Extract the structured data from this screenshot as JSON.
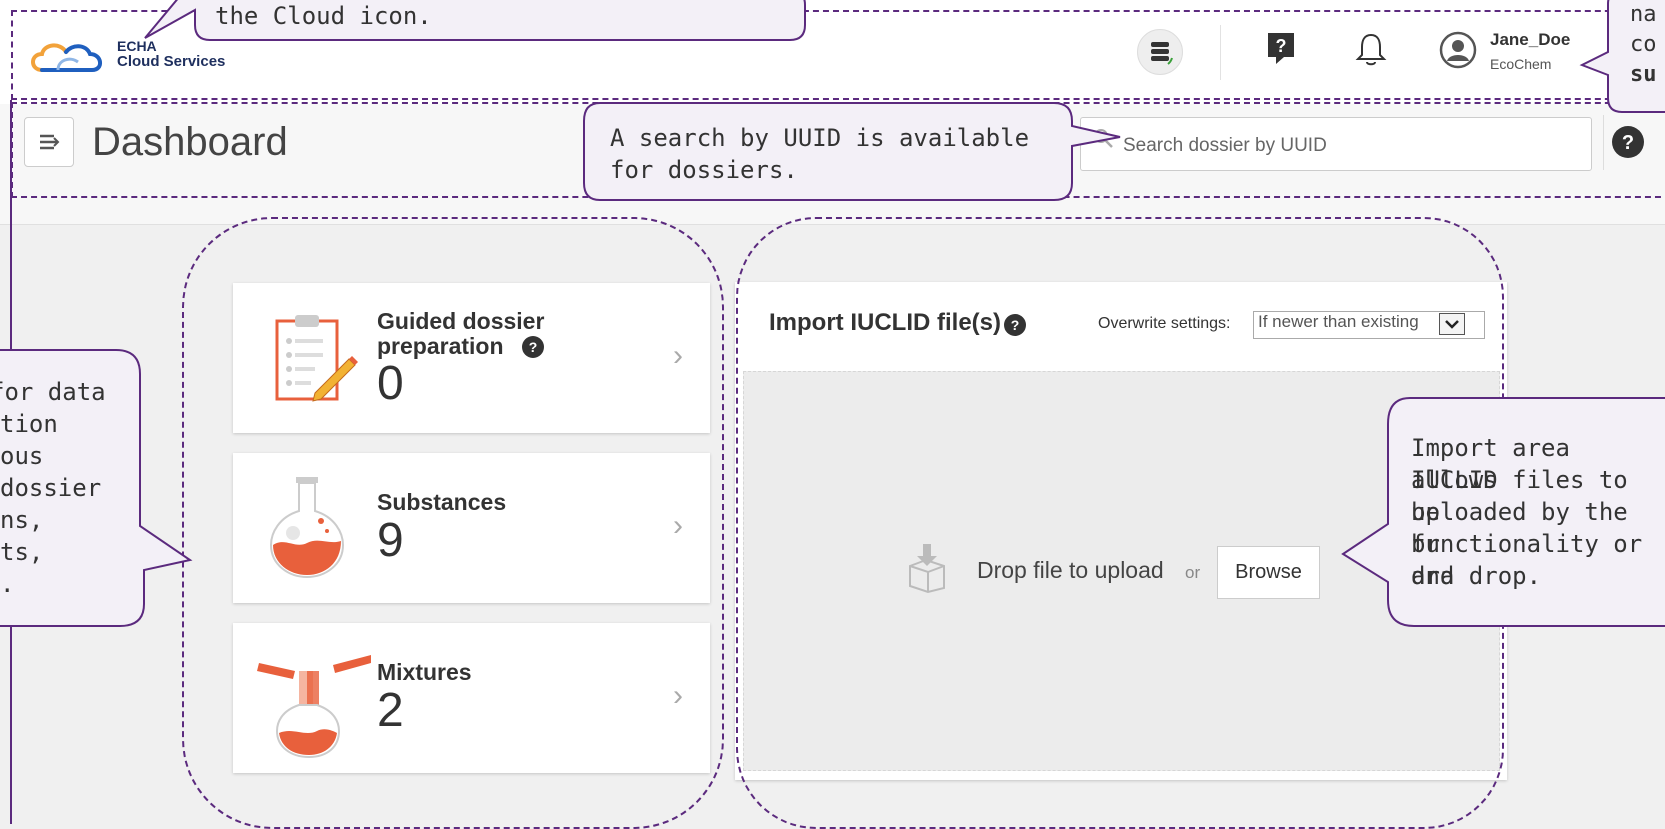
{
  "header": {
    "logo_line1": "ECHA",
    "logo_line2": "Cloud Services",
    "user_name": "Jane_Doe",
    "user_org": "EcoChem"
  },
  "dashboard": {
    "title": "Dashboard",
    "search_placeholder": "Search dossier by UUID"
  },
  "cards": [
    {
      "title_line1": "Guided dossier",
      "title_line2": "preparation",
      "count": "0"
    },
    {
      "title": "Substances",
      "count": "9"
    },
    {
      "title": "Mixtures",
      "count": "2"
    }
  ],
  "import": {
    "title": "Import IUCLID file(s)",
    "overwrite_label": "Overwrite settings:",
    "overwrite_value": "If newer than existing",
    "drop_text": "Drop file to upload",
    "or_text": "or",
    "browse_label": "Browse"
  },
  "callouts": {
    "top_left": "the Cloud icon.",
    "search": [
      "A search by UUID is available",
      "for dossiers."
    ],
    "left": [
      " for data",
      "tion",
      "ous",
      "dossier",
      "ns,",
      "ts,",
      "."
    ],
    "import": [
      "Import area allows",
      "IUCLID files to be",
      "uploaded by the br",
      "functionality or dra",
      "and drop."
    ],
    "top_right": [
      "na",
      "co",
      "su"
    ]
  },
  "colors": {
    "accent_orange": "#e8603c",
    "brand_navy": "#1e2f5e",
    "annotation_purple": "#5b2a7e"
  }
}
